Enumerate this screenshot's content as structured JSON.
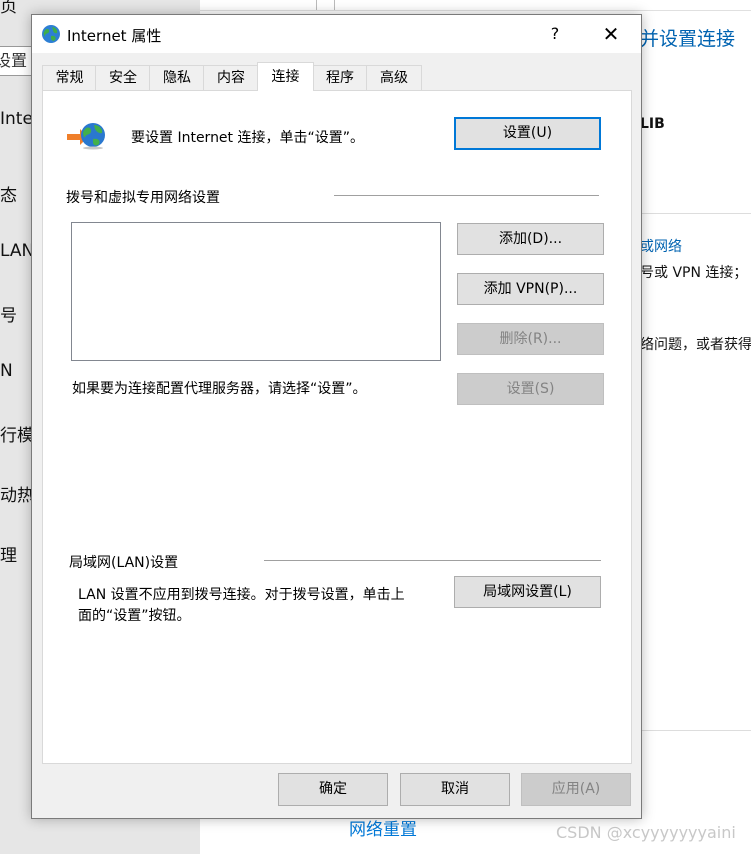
{
  "background": {
    "left_items": [
      "页",
      "设置",
      "Inter",
      "态",
      "LAN",
      "号",
      "N",
      "行模",
      "动热",
      "理"
    ],
    "right_title": "并设置连接",
    "right_fragments": {
      "lib": "LIB",
      "link": "或网络",
      "vpn": "号或 VPN 连接；",
      "issue": "络问题，或者获得"
    },
    "reset_link": "网络重置",
    "watermark": "CSDN @xcyyyyyyyaini"
  },
  "dialog": {
    "title": "Internet 属性",
    "help_label": "?",
    "close_label": "✕",
    "tabs": [
      "常规",
      "安全",
      "隐私",
      "内容",
      "连接",
      "程序",
      "高级"
    ],
    "active_tab": "连接",
    "setup_text": "要设置 Internet 连接，单击“设置”。",
    "setup_button": "设置(U)",
    "dialup_group_label": "拨号和虚拟专用网络设置",
    "add_button": "添加(D)...",
    "add_vpn_button": "添加 VPN(P)...",
    "remove_button": "删除(R)...",
    "proxy_text": "如果要为连接配置代理服务器，请选择“设置”。",
    "settings_button": "设置(S)",
    "lan_group_label": "局域网(LAN)设置",
    "lan_text_line1": "LAN 设置不应用到拨号连接。对于拨号设置，单击上",
    "lan_text_line2": "面的“设置”按钮。",
    "lan_settings_button": "局域网设置(L)",
    "ok_button": "确定",
    "cancel_button": "取消",
    "apply_button": "应用(A)"
  },
  "icons": {
    "title_icon": "globe-icon",
    "setup_icon": "network-globe-arrow-icon"
  },
  "colors": {
    "accent": "#0078d7",
    "link": "#0063b1",
    "disabled_text": "#838383"
  }
}
